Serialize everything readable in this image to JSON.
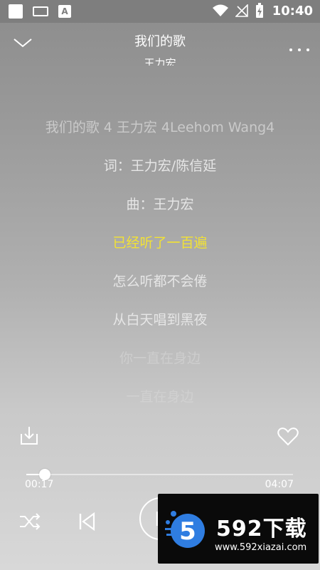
{
  "statusbar": {
    "time": "10:40",
    "icons": [
      "notification-square-icon",
      "keyboard-icon",
      "a-notification-icon",
      "wifi-icon",
      "no-signal-icon",
      "battery-charging-icon"
    ],
    "a_glyph": "A"
  },
  "header": {
    "title": "我们的歌",
    "artist": "王力宏",
    "back_icon": "chevron-down-icon",
    "more_icon": "more-dots-icon"
  },
  "lyrics": [
    {
      "text": "我们的歌 4 王力宏 4Leehom Wang4",
      "state": "past"
    },
    {
      "text": "词：王力宏/陈信延",
      "state": "past"
    },
    {
      "text": "曲：王力宏",
      "state": "past"
    },
    {
      "text": "已经听了一百遍",
      "state": "active"
    },
    {
      "text": "怎么听都不会倦",
      "state": "next"
    },
    {
      "text": "从白天唱到黑夜",
      "state": "next"
    },
    {
      "text": "你一直在身边",
      "state": "next"
    },
    {
      "text": "一直在身边",
      "state": "next"
    }
  ],
  "actions": {
    "download_icon": "download-icon",
    "favorite_icon": "heart-icon"
  },
  "player": {
    "current_time": "00:17",
    "total_time": "04:07",
    "progress_fraction": 0.07,
    "shuffle_icon": "shuffle-icon",
    "prev_icon": "previous-icon",
    "play_icon": "pause-icon"
  },
  "watermark": {
    "brand": "592下载",
    "url": "www.592xiazai.com",
    "logo_digit": "5"
  },
  "colors": {
    "active_lyric": "#f2e234",
    "text": "#ffffff",
    "watermark_bg": "#0a0a0a",
    "logo_blue": "#2f7de1"
  }
}
